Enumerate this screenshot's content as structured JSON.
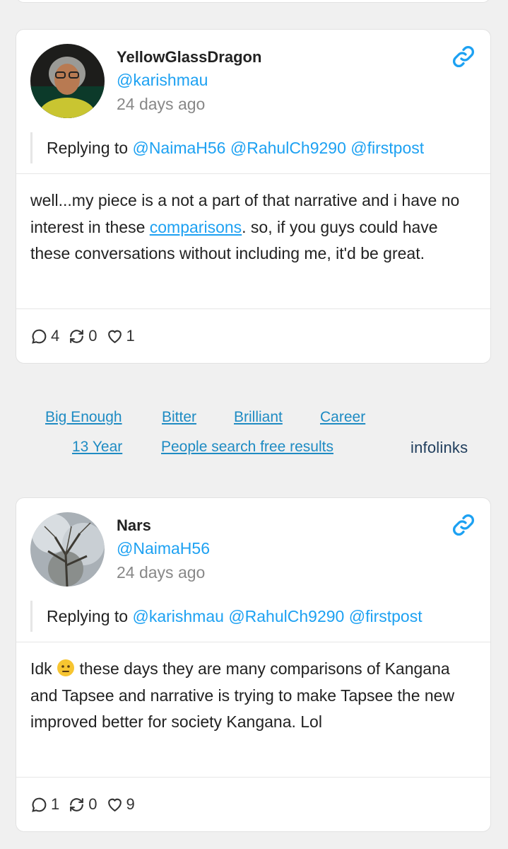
{
  "posts": [
    {
      "name": "YellowGlassDragon",
      "handle": "@karishmau",
      "time": "24 days ago",
      "replying_prefix": "Replying to",
      "mentions": [
        "@NaimaH56",
        "@RahulCh9290",
        "@firstpost"
      ],
      "body_before": "well...my piece is a not a part of that narrative and i have no interest in these ",
      "body_link": "comparisons",
      "body_after": ". so, if you guys could have these conversations without including me, it'd be great.",
      "replies": "4",
      "retweets": "0",
      "likes": "1"
    },
    {
      "name": "Nars",
      "handle": "@NaimaH56",
      "time": "24 days ago",
      "replying_prefix": "Replying to",
      "mentions": [
        "@karishmau",
        "@RahulCh9290",
        "@firstpost"
      ],
      "body_before": "Idk",
      "body_after": " these days they are many comparisons of Kangana and Tapsee and narrative is trying to make Tapsee the new improved better for society Kangana. Lol",
      "replies": "1",
      "retweets": "0",
      "likes": "9"
    }
  ],
  "ads": {
    "row1": [
      "Big Enough",
      "Bitter",
      "Brilliant",
      "Career"
    ],
    "row2": [
      "13 Year",
      "People search free results"
    ],
    "brand": "infolinks"
  },
  "colors": {
    "link": "#1da1f2",
    "background": "#f0f0f0"
  }
}
